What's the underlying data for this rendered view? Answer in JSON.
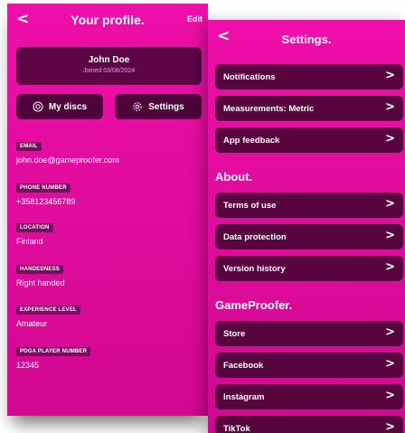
{
  "profile": {
    "back_glyph": "<",
    "title": "Your profile.",
    "edit_label": "Edit",
    "user": {
      "name": "John Doe",
      "joined": "Joined 03/08/2024"
    },
    "buttons": {
      "my_discs": "My discs",
      "settings": "Settings"
    },
    "fields": [
      {
        "label": "EMAIL",
        "value": "john.doe@gameproofer.com"
      },
      {
        "label": "PHONE NUMBER",
        "value": "+358123456789"
      },
      {
        "label": "LOCATION",
        "value": "Finland"
      },
      {
        "label": "HANDEDNESS",
        "value": "Right handed"
      },
      {
        "label": "EXPERIENCE LEVEL",
        "value": "Amateur"
      },
      {
        "label": "PDGA PLAYER NUMBER",
        "value": "12345"
      }
    ]
  },
  "settings": {
    "back_glyph": "<",
    "title": "Settings.",
    "chevron": ">",
    "general_items": [
      {
        "label": "Notifications"
      },
      {
        "label": "Measurements: Metric"
      },
      {
        "label": "App feedback"
      }
    ],
    "about": {
      "heading": "About.",
      "items": [
        {
          "label": "Terms of use"
        },
        {
          "label": "Data protection"
        },
        {
          "label": "Version history"
        }
      ]
    },
    "gameproofer": {
      "heading": "GameProofer.",
      "items": [
        {
          "label": "Store"
        },
        {
          "label": "Facebook"
        },
        {
          "label": "Instagram"
        },
        {
          "label": "TikTok"
        }
      ]
    }
  },
  "colors": {
    "background_pink": "#e60ca3",
    "card_dark": "#57043f",
    "badge_purple": "#7b0a61"
  },
  "icons": {
    "my_discs": "disc-icon",
    "settings": "gear-icon"
  }
}
